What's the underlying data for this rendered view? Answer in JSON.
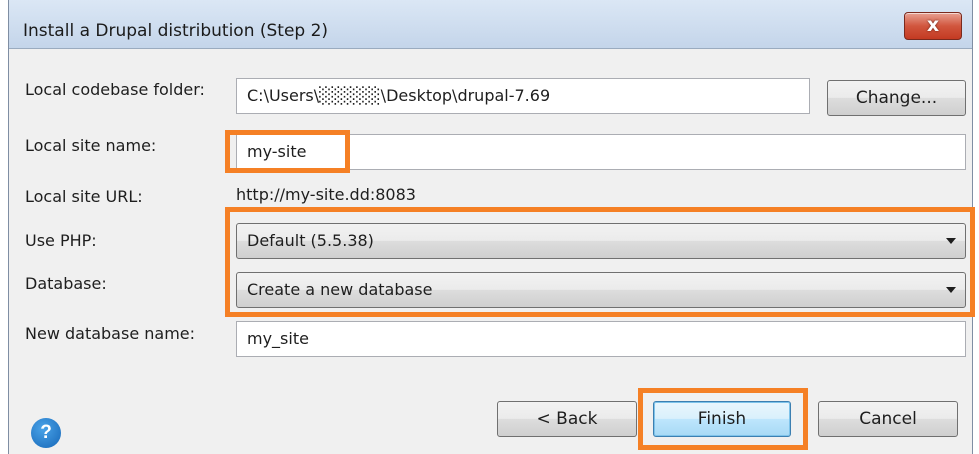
{
  "window": {
    "title": "Install a Drupal distribution (Step 2)",
    "close_glyph": "x"
  },
  "form": {
    "codebase": {
      "label": "Local codebase folder:",
      "value": "C:\\Users\\░░░░░\\Desktop\\drupal-7.69",
      "button_label": "Change..."
    },
    "site_name": {
      "label": "Local site name:",
      "value": "my-site"
    },
    "site_url": {
      "label": "Local site URL:",
      "value": "http://my-site.dd:8083"
    },
    "php": {
      "label": "Use PHP:",
      "selected": "Default (5.5.38)"
    },
    "database": {
      "label": "Database:",
      "selected": "Create a new database"
    },
    "new_db_name": {
      "label": "New database name:",
      "value": "my_site"
    }
  },
  "buttons": {
    "back": "< Back",
    "finish": "Finish",
    "cancel": "Cancel"
  },
  "help": {
    "glyph": "?"
  },
  "colors": {
    "highlight": "#f58025",
    "title_bar": "#c4d5ea",
    "close_button": "#c43a22",
    "dialog_bg": "#f0f0f0"
  }
}
